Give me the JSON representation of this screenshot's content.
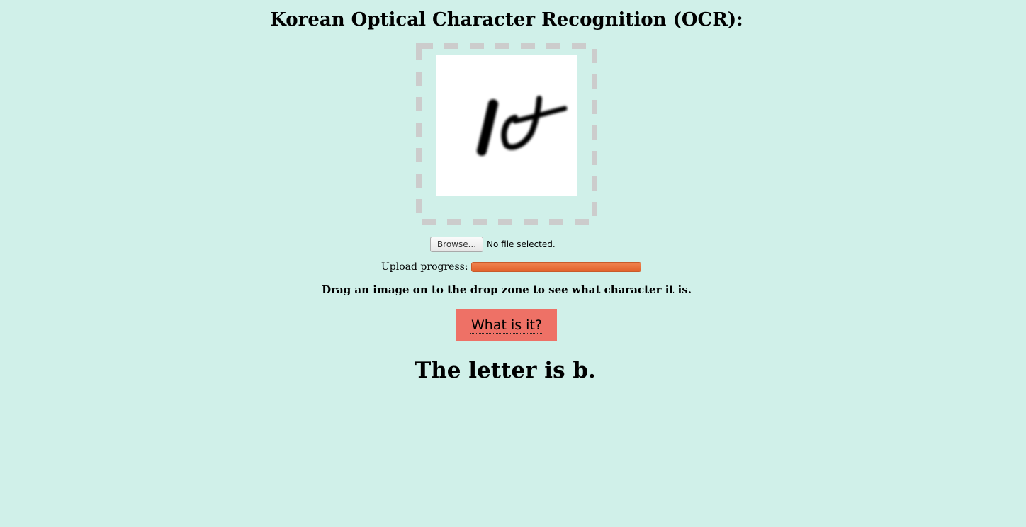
{
  "page": {
    "title": "Korean Optical Character Recognition (OCR):"
  },
  "file_input": {
    "browse_label": "Browse...",
    "status": "No file selected."
  },
  "upload": {
    "label": "Upload progress:",
    "progress_percent": 100
  },
  "instructions": "Drag an image on to the drop zone to see what character it is.",
  "action_button": {
    "label": "What is it?"
  },
  "result": "The letter is b.",
  "colors": {
    "background": "#d0f0e9",
    "button": "#ee7166",
    "progress": "#e2612a",
    "drop_zone_border": "#cccccc"
  }
}
